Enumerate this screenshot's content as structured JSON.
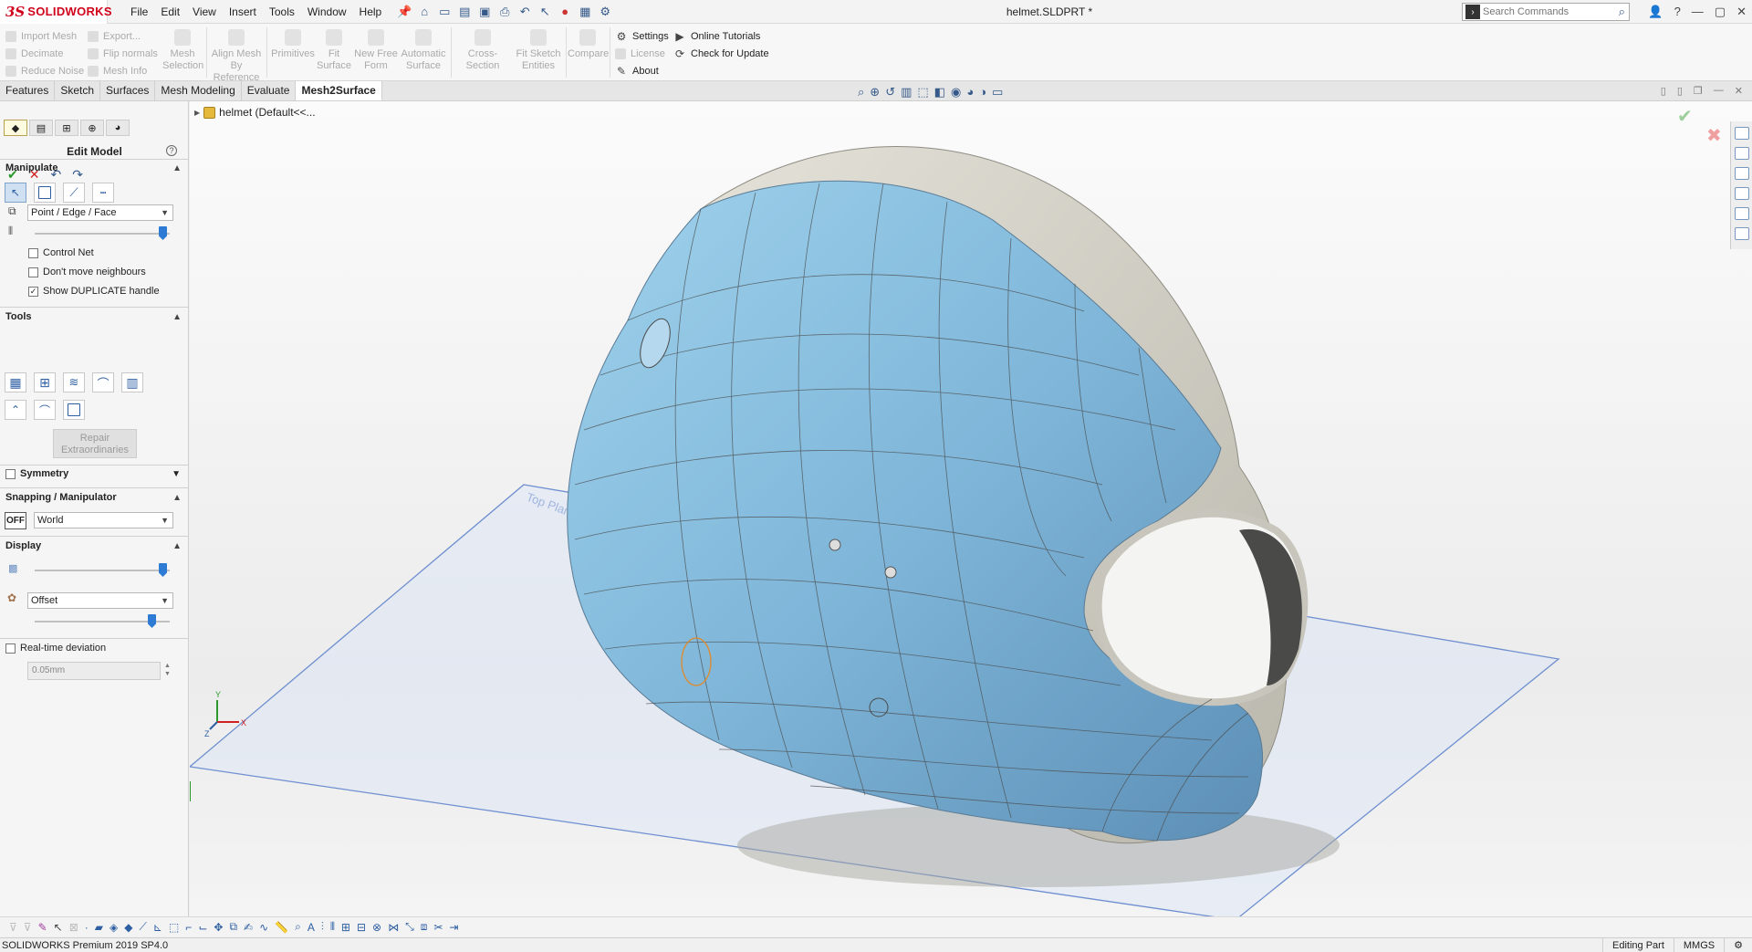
{
  "app": {
    "brand": "SOLIDWORKS",
    "document_title": "helmet.SLDPRT *",
    "menu": [
      "File",
      "Edit",
      "View",
      "Insert",
      "Tools",
      "Window",
      "Help"
    ],
    "search_placeholder": "Search Commands",
    "window_controls": [
      "—",
      "▢",
      "✕"
    ]
  },
  "ribbon": {
    "col1": [
      "Import Mesh",
      "Decimate",
      "Reduce Noise"
    ],
    "col2": [
      "Export...",
      "Flip normals",
      "Mesh Info"
    ],
    "big_buttons": [
      {
        "label": "Mesh Selection"
      },
      {
        "label": "Align Mesh By Reference"
      },
      {
        "label": "Primitives"
      },
      {
        "label": "Fit Surface"
      },
      {
        "label": "New Free Form"
      },
      {
        "label": "Automatic Surface"
      },
      {
        "label": "Cross-Section"
      },
      {
        "label": "Fit Sketch Entities"
      },
      {
        "label": "Compare"
      }
    ],
    "col3": [
      "Settings",
      "License",
      "About"
    ],
    "col4": [
      "Online Tutorials",
      "Check for Update"
    ]
  },
  "tabs": [
    "Features",
    "Sketch",
    "Surfaces",
    "Mesh Modeling",
    "Evaluate",
    "Mesh2Surface"
  ],
  "active_tab": "Mesh2Surface",
  "panel": {
    "title": "Edit Model",
    "manipulate": {
      "heading": "Manipulate",
      "mode": "Point / Edge / Face",
      "control_net": "Control Net",
      "dont_move": "Don't move neighbours",
      "show_duplicate": "Show DUPLICATE handle"
    },
    "tools": {
      "heading": "Tools",
      "repair": "Repair Extraordinaries"
    },
    "symmetry": "Symmetry",
    "snapping": {
      "heading": "Snapping / Manipulator",
      "toggle": "OFF",
      "frame": "World"
    },
    "display": {
      "heading": "Display",
      "mode": "Offset"
    },
    "deviation": {
      "label": "Real-time deviation",
      "value": "0.05mm"
    }
  },
  "viewport": {
    "tree_item": "helmet  (Default<<...",
    "plane_label": "Top Plane",
    "axes": {
      "x": "X",
      "y": "Y",
      "z": "Z"
    }
  },
  "status": {
    "product": "SOLIDWORKS Premium 2019 SP4.0",
    "mode": "Editing Part",
    "units": "MMGS"
  }
}
